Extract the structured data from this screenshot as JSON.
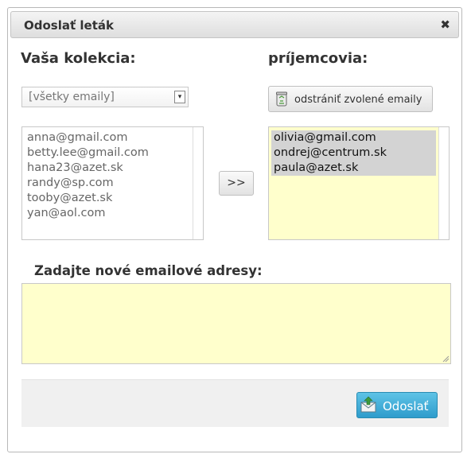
{
  "dialog": {
    "title": "Odoslať leták",
    "close_glyph": "✖"
  },
  "left": {
    "heading": "Vaša kolekcia:",
    "select_value": "[všetky emaily]",
    "emails": [
      "anna@gmail.com",
      "betty.lee@gmail.com",
      "hana23@azet.sk",
      "randy@sp.com",
      "tooby@azet.sk",
      "yan@aol.com"
    ]
  },
  "move_button_label": ">>",
  "right": {
    "heading": "príjemcovia:",
    "remove_button_label": "odstrániť zvolené emaily",
    "emails": [
      "olivia@gmail.com",
      "ondrej@centrum.sk",
      "paula@azet.sk"
    ]
  },
  "new_emails": {
    "heading": "Zadajte nové emailové adresy:",
    "value": ""
  },
  "send_button_label": "Odoslať",
  "icons": {
    "close": "close-icon",
    "trash": "trash-icon",
    "send": "mail-send-icon",
    "dropdown": "chevron-down-icon"
  },
  "colors": {
    "recipient_bg": "#ffffcc",
    "selected_bg": "#d3d3d3",
    "send_button": "#3aa6d3"
  }
}
